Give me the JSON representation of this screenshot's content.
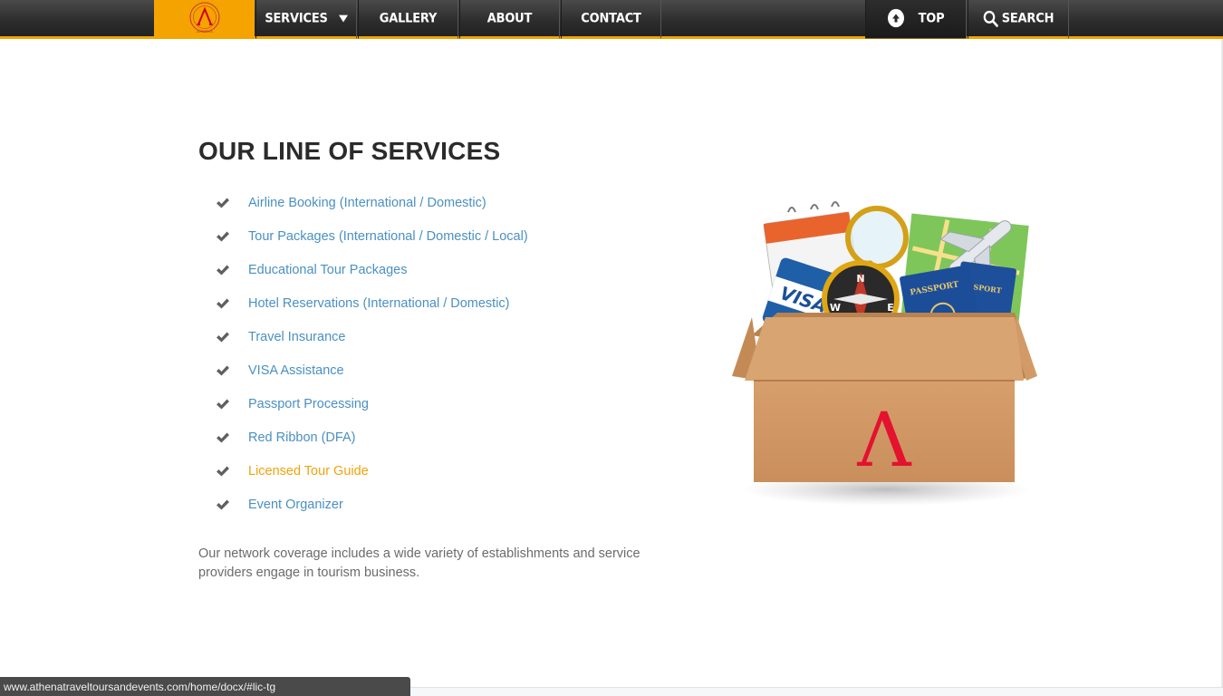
{
  "nav": {
    "logo_icon": "athena-logo-icon",
    "items": [
      {
        "label": "SERVICES",
        "has_dropdown": true
      },
      {
        "label": "GALLERY"
      },
      {
        "label": "ABOUT"
      },
      {
        "label": "CONTACT"
      }
    ],
    "top_label": "TOP",
    "search_label": "SEARCH",
    "accent_color": "#f5a300"
  },
  "main": {
    "title": "OUR LINE OF SERVICES",
    "services": [
      {
        "label": "Airline Booking (International / Domestic)"
      },
      {
        "label": "Tour Packages (International / Domestic / Local)"
      },
      {
        "label": "Educational Tour Packages"
      },
      {
        "label": "Hotel Reservations (International / Domestic)"
      },
      {
        "label": "Travel Insurance"
      },
      {
        "label": "VISA Assistance"
      },
      {
        "label": "Passport Processing"
      },
      {
        "label": "Red Ribbon (DFA)"
      },
      {
        "label": "Licensed Tour Guide",
        "active": true
      },
      {
        "label": "Event Organizer"
      }
    ],
    "coverage_text": "Our network coverage includes a wide variety of establishments and service providers engage in tourism business.",
    "illustration": {
      "visa_text": "VISA",
      "passport_text": "PASSPORT",
      "passport_back_text": "SPORT",
      "compass_n": "N",
      "compass_w": "W",
      "compass_e": "E",
      "box_logo": "Λ"
    },
    "link_color": "#4a90c2",
    "active_link_color": "#f0a20a"
  },
  "statusbar": {
    "url": "www.athenatraveltoursandevents.com/home/docx/#lic-tg"
  }
}
